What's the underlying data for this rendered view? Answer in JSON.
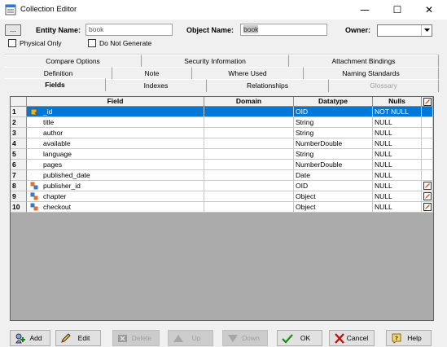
{
  "window": {
    "title": "Collection Editor",
    "minimize": "—",
    "maximize": "☐",
    "close": "✕"
  },
  "header": {
    "dots_label": "...",
    "entity_name_label": "Entity Name:",
    "entity_name_value": "book",
    "object_name_label": "Object Name:",
    "object_name_value": "book",
    "owner_label": "Owner:",
    "owner_value": "",
    "physical_only_label": "Physical Only",
    "physical_only_checked": false,
    "do_not_generate_label": "Do Not Generate",
    "do_not_generate_checked": false
  },
  "tabs": {
    "row1": [
      "Compare Options",
      "Security Information",
      "Attachment Bindings"
    ],
    "row2": [
      "Definition",
      "Note",
      "Where Used",
      "Naming Standards"
    ],
    "row3": [
      "Fields",
      "Indexes",
      "Relationships",
      "Glossary"
    ],
    "active": "Fields",
    "disabled": [
      "Glossary"
    ]
  },
  "grid": {
    "columns": [
      "Field",
      "Domain",
      "Datatype",
      "Nulls"
    ],
    "rows": [
      {
        "num": "1",
        "icon": "key-field-icon",
        "field": "_id",
        "domain": "",
        "datatype": "OID",
        "nulls": "NOT NULL",
        "edit": false,
        "selected": true
      },
      {
        "num": "2",
        "icon": "",
        "field": "title",
        "domain": "",
        "datatype": "String",
        "nulls": "NULL",
        "edit": false,
        "selected": false
      },
      {
        "num": "3",
        "icon": "",
        "field": "author",
        "domain": "",
        "datatype": "String",
        "nulls": "NULL",
        "edit": false,
        "selected": false
      },
      {
        "num": "4",
        "icon": "",
        "field": "available",
        "domain": "",
        "datatype": "NumberDouble",
        "nulls": "NULL",
        "edit": false,
        "selected": false
      },
      {
        "num": "5",
        "icon": "",
        "field": "language",
        "domain": "",
        "datatype": "String",
        "nulls": "NULL",
        "edit": false,
        "selected": false
      },
      {
        "num": "6",
        "icon": "",
        "field": "pages",
        "domain": "",
        "datatype": "NumberDouble",
        "nulls": "NULL",
        "edit": false,
        "selected": false
      },
      {
        "num": "7",
        "icon": "",
        "field": "published_date",
        "domain": "",
        "datatype": "Date",
        "nulls": "NULL",
        "edit": false,
        "selected": false
      },
      {
        "num": "8",
        "icon": "reference-field-icon",
        "field": "publisher_id",
        "domain": "",
        "datatype": "OID",
        "nulls": "NULL",
        "edit": true,
        "selected": false
      },
      {
        "num": "9",
        "icon": "object-field-icon",
        "field": "chapter",
        "domain": "",
        "datatype": "Object",
        "nulls": "NULL",
        "edit": true,
        "selected": false
      },
      {
        "num": "10",
        "icon": "object-field-icon",
        "field": "checkout",
        "domain": "",
        "datatype": "Object",
        "nulls": "NULL",
        "edit": true,
        "selected": false
      }
    ]
  },
  "buttons": {
    "add": "Add",
    "edit": "Edit",
    "delete": "Delete",
    "up": "Up",
    "down": "Down",
    "ok": "OK",
    "cancel": "Cancel",
    "help": "Help"
  },
  "colors": {
    "selection": "#0078d7",
    "grid_bg": "#ababab"
  }
}
